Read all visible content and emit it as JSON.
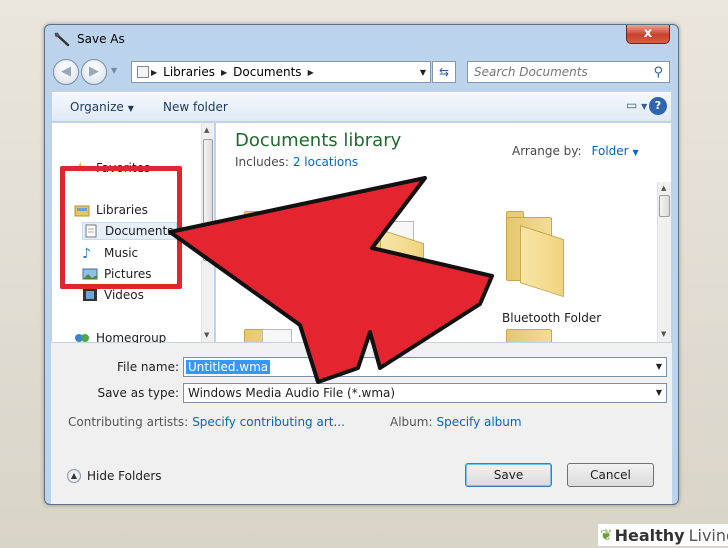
{
  "window": {
    "title": "Save As",
    "close_glyph": "x"
  },
  "nav": {
    "back_glyph": "◀",
    "forward_glyph": "▶",
    "breadcrumb": [
      "Libraries",
      "Documents"
    ],
    "search_placeholder": "Search Documents"
  },
  "toolbar": {
    "organize_label": "Organize",
    "new_folder_label": "New folder",
    "help_glyph": "?"
  },
  "sidebar": {
    "favorites": "Favorites",
    "libraries": "Libraries",
    "documents": "Documents",
    "music": "Music",
    "pictures": "Pictures",
    "videos": "Videos",
    "homegroup": "Homegroup"
  },
  "main": {
    "library_title": "Documents library",
    "includes_label": "Includes:",
    "includes_link": "2 locations",
    "arrange_label": "Arrange by:",
    "arrange_value": "Folder",
    "bluetooth_folder": "Bluetooth Folder"
  },
  "form": {
    "file_name_label": "File name:",
    "file_name_value": "Untitled.wma",
    "save_type_label": "Save as type:",
    "save_type_value": "Windows Media Audio File (*.wma)",
    "artists_label": "Contributing artists:",
    "artists_link": "Specify contributing art...",
    "album_label": "Album:",
    "album_link": "Specify album"
  },
  "footer": {
    "hide_folders": "Hide Folders",
    "save_label": "Save",
    "cancel_label": "Cancel"
  },
  "overlay": {
    "highlight_color": "#e0262d",
    "watermark_brand": "Healthy",
    "watermark_suffix": "Living"
  }
}
